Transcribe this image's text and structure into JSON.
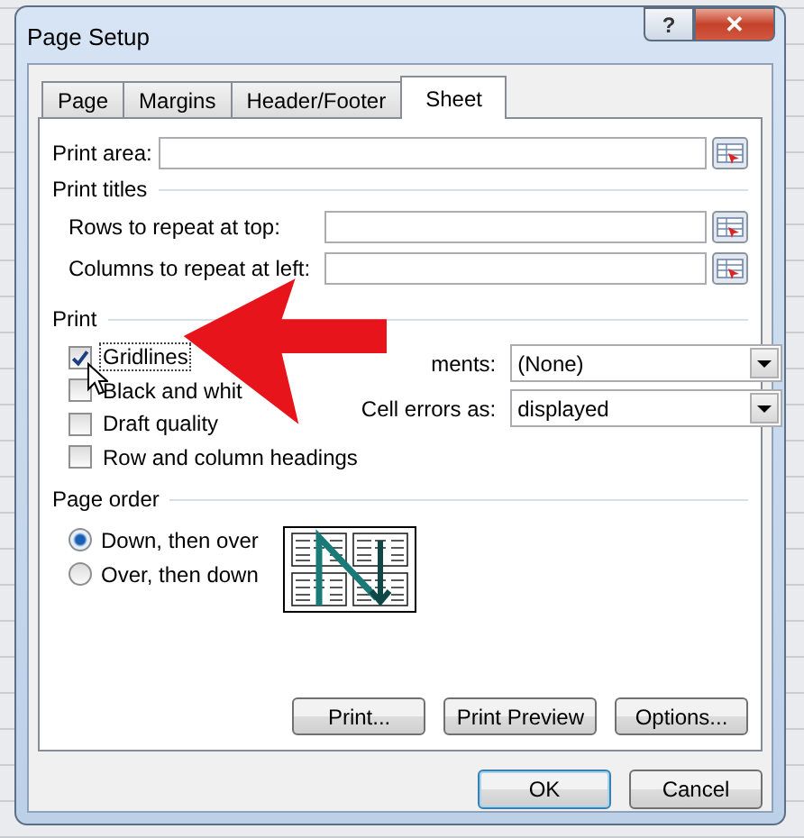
{
  "window": {
    "title": "Page Setup",
    "help_button": "?",
    "close_button": "✕"
  },
  "tabs": [
    {
      "label": "Page",
      "selected": false
    },
    {
      "label": "Margins",
      "selected": false
    },
    {
      "label": "Header/Footer",
      "selected": false
    },
    {
      "label": "Sheet",
      "selected": true
    }
  ],
  "print_area": {
    "label": "Print area:"
  },
  "print_titles": {
    "heading": "Print titles",
    "rows": [
      {
        "label": "Rows to repeat at top:"
      },
      {
        "label": "Columns to repeat at left:"
      }
    ]
  },
  "print": {
    "heading": "Print",
    "options": [
      {
        "label": "Gridlines",
        "checked": true
      },
      {
        "label": "Black and whit",
        "checked": false
      },
      {
        "label": "Draft quality",
        "checked": false
      },
      {
        "label": "Row and column headings",
        "checked": false
      }
    ],
    "selects": [
      {
        "label": "ments:",
        "value": "(None)"
      },
      {
        "label": "Cell errors as:",
        "value": "displayed"
      }
    ]
  },
  "page_order": {
    "heading": "Page order",
    "options": [
      {
        "label": "Down, then over",
        "selected": true
      },
      {
        "label": "Over, then down",
        "selected": false
      }
    ]
  },
  "buttons": [
    {
      "label": "Print..."
    },
    {
      "label": "Print Preview"
    },
    {
      "label": "Options..."
    }
  ],
  "footer_buttons": [
    {
      "label": "OK",
      "default": true
    },
    {
      "label": "Cancel",
      "default": false
    }
  ]
}
